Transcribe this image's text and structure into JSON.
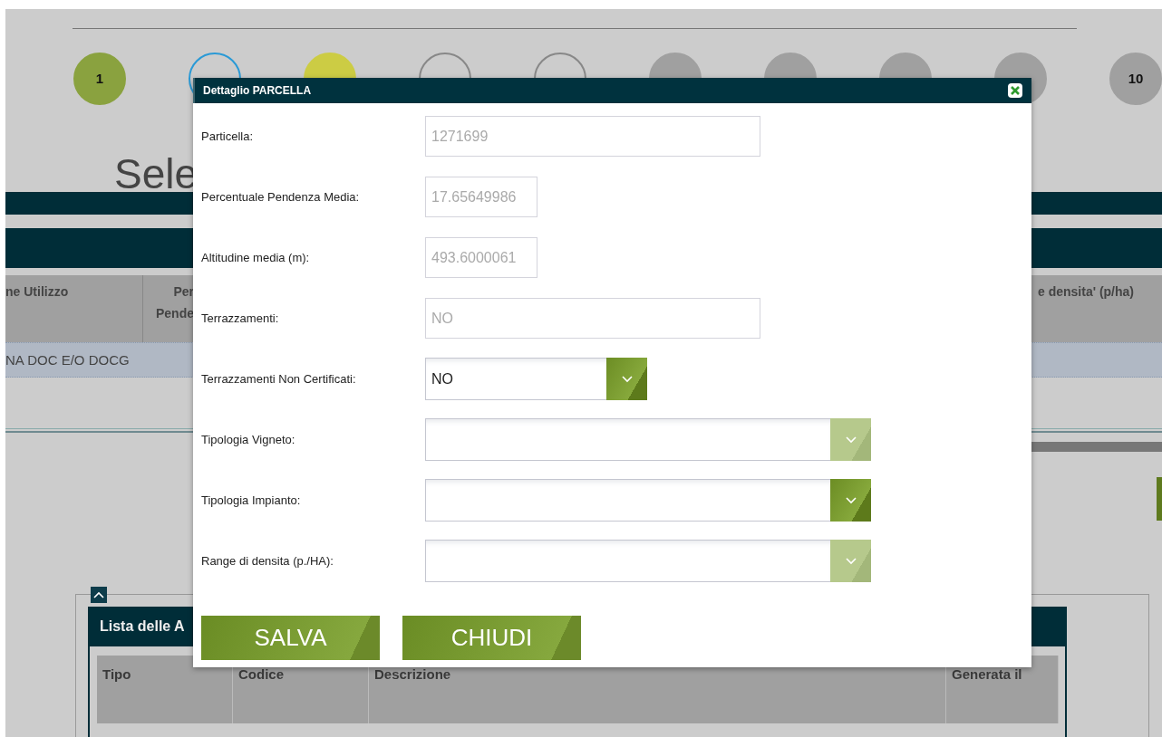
{
  "background": {
    "steps": [
      {
        "label": "1",
        "kind": "done"
      },
      {
        "kind": "current"
      },
      {
        "kind": "warning"
      },
      {
        "kind": "open"
      },
      {
        "kind": "open"
      },
      {
        "kind": "locked"
      },
      {
        "kind": "locked"
      },
      {
        "kind": "locked"
      },
      {
        "kind": "locked"
      },
      {
        "label": "10",
        "kind": "locked"
      }
    ],
    "heading": "Sele",
    "grid": {
      "columns": [
        "ne Utilizzo",
        "Per Pende",
        "e densita' (p/ha)"
      ],
      "rows": [
        {
          "cells": [
            "NA DOC E/O DOCG"
          ],
          "selected": true
        }
      ]
    },
    "panel": {
      "title": "Lista delle A",
      "expanded": true,
      "columns": [
        "Tipo",
        "Codice",
        "Descrizione",
        "Generata il"
      ]
    }
  },
  "dialog": {
    "title": "Dettaglio PARCELLA",
    "fields": [
      {
        "label": "Particella:",
        "kind": "text",
        "value": "1271699"
      },
      {
        "label": "Percentuale Pendenza Media:",
        "kind": "number",
        "value": "17.65649986"
      },
      {
        "label": "Altitudine media (m):",
        "kind": "number",
        "value": "493.6000061"
      },
      {
        "label": "Terrazzamenti:",
        "kind": "text",
        "value": "NO"
      },
      {
        "label": "Terrazzamenti Non Certificati:",
        "kind": "choice",
        "value": "NO",
        "disabled": false
      },
      {
        "label": "Tipologia Vigneto:",
        "kind": "select",
        "disabled": true
      },
      {
        "label": "Tipologia Impianto:",
        "kind": "select",
        "disabled": false
      },
      {
        "label": "Range di densita (p./HA):",
        "kind": "select",
        "disabled": true
      }
    ],
    "buttons": [
      "SALVA",
      "CHIUDI"
    ]
  }
}
